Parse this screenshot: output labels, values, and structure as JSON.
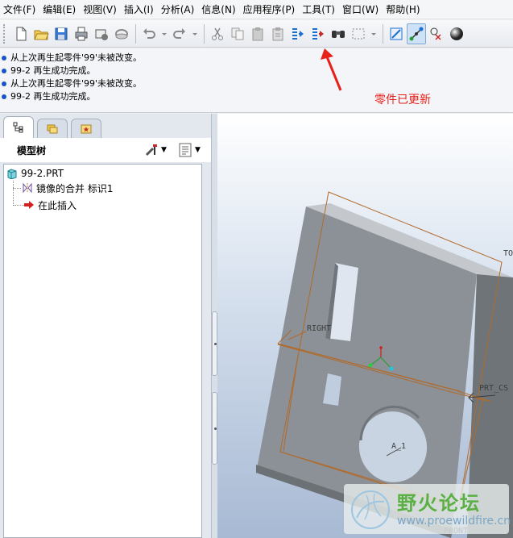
{
  "menubar": {
    "items": [
      "文件(F)",
      "编辑(E)",
      "视图(V)",
      "插入(I)",
      "分析(A)",
      "信息(N)",
      "应用程序(P)",
      "工具(T)",
      "窗口(W)",
      "帮助(H)"
    ]
  },
  "toolbar": {
    "buttons": [
      "new-icon",
      "open-icon",
      "save-icon",
      "print-icon",
      "send-mail-icon",
      "link-icon",
      "undo-icon",
      "redo-icon",
      "cut-icon",
      "copy-icon",
      "paste-icon",
      "paste-special-icon",
      "regenerate-icon",
      "regen-manager-icon",
      "find-icon",
      "select-box-icon",
      "datum-plane-icon",
      "datum-axis-icon",
      "datum-point-icon",
      "shading-icon"
    ],
    "active_button": "datum-axis-icon",
    "accent_color": "#1a6fd1"
  },
  "messages": [
    "从上次再生起零件'99'未被改变。",
    "99-2 再生成功完成。",
    "从上次再生起零件'99'未被改变。",
    "99-2 再生成功完成。"
  ],
  "annotation": {
    "text": "零件已更新",
    "color": "#e8201a"
  },
  "left_panel": {
    "tabs": [
      "model-tree-tab",
      "layer-tab",
      "favorites-tab"
    ],
    "title": "模型树",
    "tree": {
      "root": "99-2.PRT",
      "children": [
        "镜像的合并 标识1",
        "在此插入"
      ]
    }
  },
  "graphics": {
    "datum_labels": [
      "TO",
      "RIGHT",
      "PRT_CS",
      "A_1",
      "FRONT"
    ]
  },
  "watermark": {
    "text_cn": "野火论坛",
    "url": "www.proewildfire.cn"
  }
}
